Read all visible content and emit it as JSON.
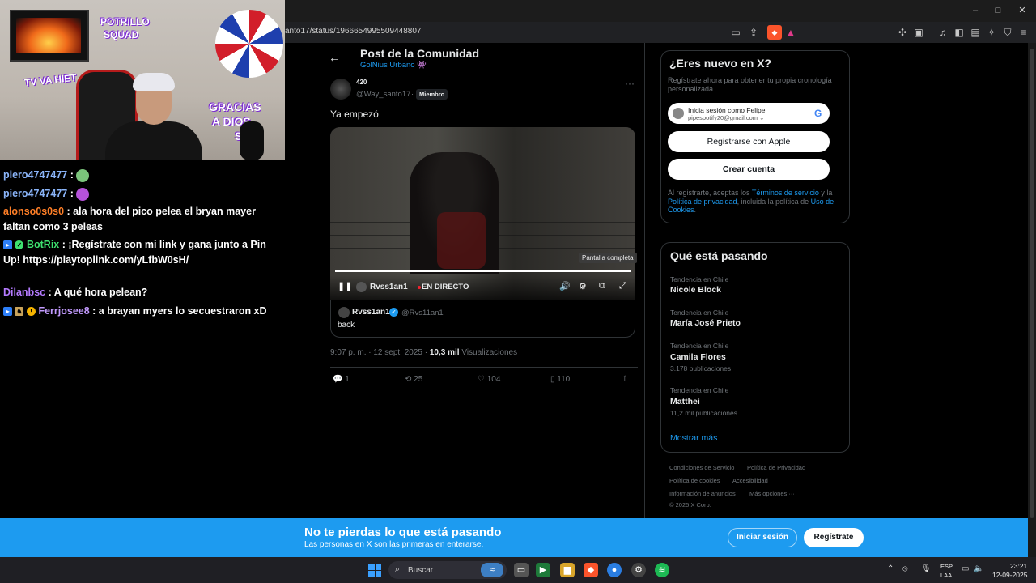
{
  "browser": {
    "url": "anto17/status/1966654995509448807",
    "window_controls": [
      "–",
      "□",
      "✕"
    ]
  },
  "webcam": {
    "overlay_words": [
      "POTRILLO",
      "SQUAD",
      "TV VA HIET",
      "GRACIAS",
      "A DIOS",
      "SE P"
    ]
  },
  "chat": {
    "messages": [
      {
        "user": "piero4747477",
        "user_color": "#8ab4f8",
        "text": "",
        "emote_color": "#7bc47b"
      },
      {
        "user": "piero4747477",
        "user_color": "#8ab4f8",
        "text": "",
        "emote_color": "#b552d9"
      },
      {
        "user": "alonso0s0s0",
        "user_color": "#ff7f27",
        "text": "ala hora del pico pelea el bryan mayer faltan como 3 peleas"
      },
      {
        "user": "BotRix",
        "user_color": "#3ee06f",
        "text": "¡Regístrate con mi link y gana junto a Pin Up! https://playtoplink.com/yLfbW0sH/"
      },
      {
        "user": "Dilanbsc",
        "user_color": "#b57bff",
        "text": "A qué hora pelean?"
      },
      {
        "user": "Ferrjosee8",
        "user_color": "#c39bff",
        "text": "a brayan myers lo secuestraron xD"
      }
    ]
  },
  "post": {
    "header_title": "Post de la Comunidad",
    "community": "GolNius Urbano 👾",
    "author_name": "420",
    "author_handle": "@Way_santo17",
    "member_badge": "Miembro",
    "text": "Ya empezó",
    "video": {
      "fullscreen_tooltip": "Pantalla completa",
      "channel": "Rvss1an1",
      "live_label": "EN DIRECTO",
      "progress": 1.0
    },
    "quote": {
      "name": "Rvss1an1",
      "handle": "@Rvs11an1",
      "text": "back"
    },
    "timestamp": "9:07 p. m. · 12 sept. 2025 · ",
    "views_count": "10,3 mil",
    "views_label": " Visualizaciones",
    "actions": {
      "replies": "1",
      "reposts": "25",
      "likes": "104",
      "bookmarks": "110"
    }
  },
  "signup_card": {
    "title": "¿Eres nuevo en X?",
    "description": "Regístrate ahora para obtener tu propia cronología personalizada.",
    "google_line1": "Inicia sesión como Felipe",
    "google_line2": "pipespotify20@gmail.com",
    "apple_label": "Registrarse con Apple",
    "create_label": "Crear cuenta",
    "legal_prefix": "Al registrarte, aceptas los ",
    "legal_terms": "Términos de servicio",
    "legal_mid": " y la ",
    "legal_privacy": "Política de privacidad",
    "legal_mid2": ", incluida la política de ",
    "legal_cookies": "Uso de Cookies",
    "legal_end": "."
  },
  "trends": {
    "title": "Qué está pasando",
    "items": [
      {
        "context": "Tendencia en Chile",
        "name": "Nicole Block",
        "count": ""
      },
      {
        "context": "Tendencia en Chile",
        "name": "María José Prieto",
        "count": ""
      },
      {
        "context": "Tendencia en Chile",
        "name": "Camila Flores",
        "count": "3.178 publicaciones"
      },
      {
        "context": "Tendencia en Chile",
        "name": "Matthei",
        "count": "11,2 mil publicaciones"
      }
    ],
    "more": "Mostrar más"
  },
  "footer_links": [
    "Condiciones de Servicio",
    "Política de Privacidad",
    "Política de cookies",
    "Accesibilidad",
    "Información de anuncios",
    "Más opciones ···",
    "© 2025 X Corp."
  ],
  "banner": {
    "title": "No te pierdas lo que está pasando",
    "subtitle": "Las personas en X son las primeras en enterarse.",
    "login": "Iniciar sesión",
    "signup": "Regístrate"
  },
  "taskbar": {
    "search_placeholder": "Buscar",
    "lang1": "ESP",
    "lang2": "LAA",
    "time": "23:21",
    "date": "12-09-2025"
  }
}
